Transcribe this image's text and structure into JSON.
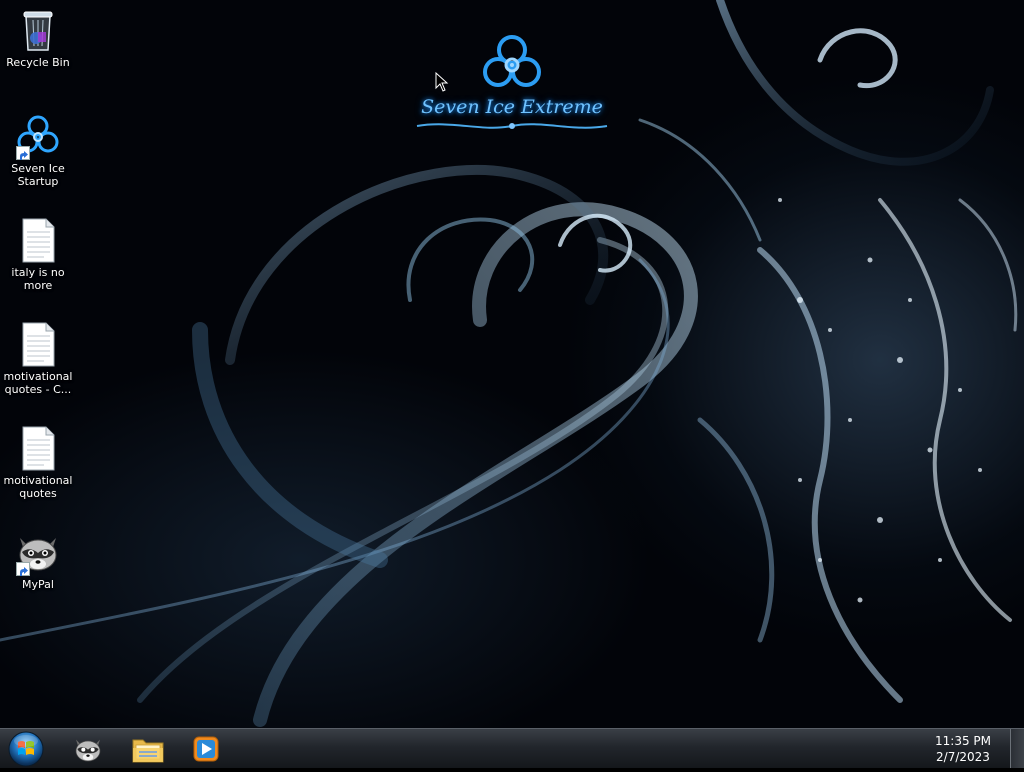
{
  "desktop": {
    "brand_text": "Seven Ice Extreme",
    "icons": [
      {
        "label": "Recycle Bin",
        "icon": "recycle-bin-icon"
      },
      {
        "label": "Seven Ice Startup",
        "icon": "biohazard-icon"
      },
      {
        "label": "italy is no more",
        "icon": "text-document-icon"
      },
      {
        "label": "motivational quotes - C...",
        "icon": "text-document-icon"
      },
      {
        "label": "motivational quotes",
        "icon": "text-document-icon"
      },
      {
        "label": "MyPal",
        "icon": "raccoon-icon"
      }
    ]
  },
  "taskbar": {
    "pinned": [
      {
        "name": "MyPal",
        "icon": "raccoon-icon"
      },
      {
        "name": "Windows Explorer",
        "icon": "folder-icon"
      },
      {
        "name": "Windows Media Player",
        "icon": "media-player-icon"
      }
    ],
    "clock": {
      "time": "11:35 PM",
      "date": "2/7/2023"
    }
  },
  "colors": {
    "accent": "#6fc2ff",
    "taskbar": "#22262c"
  }
}
